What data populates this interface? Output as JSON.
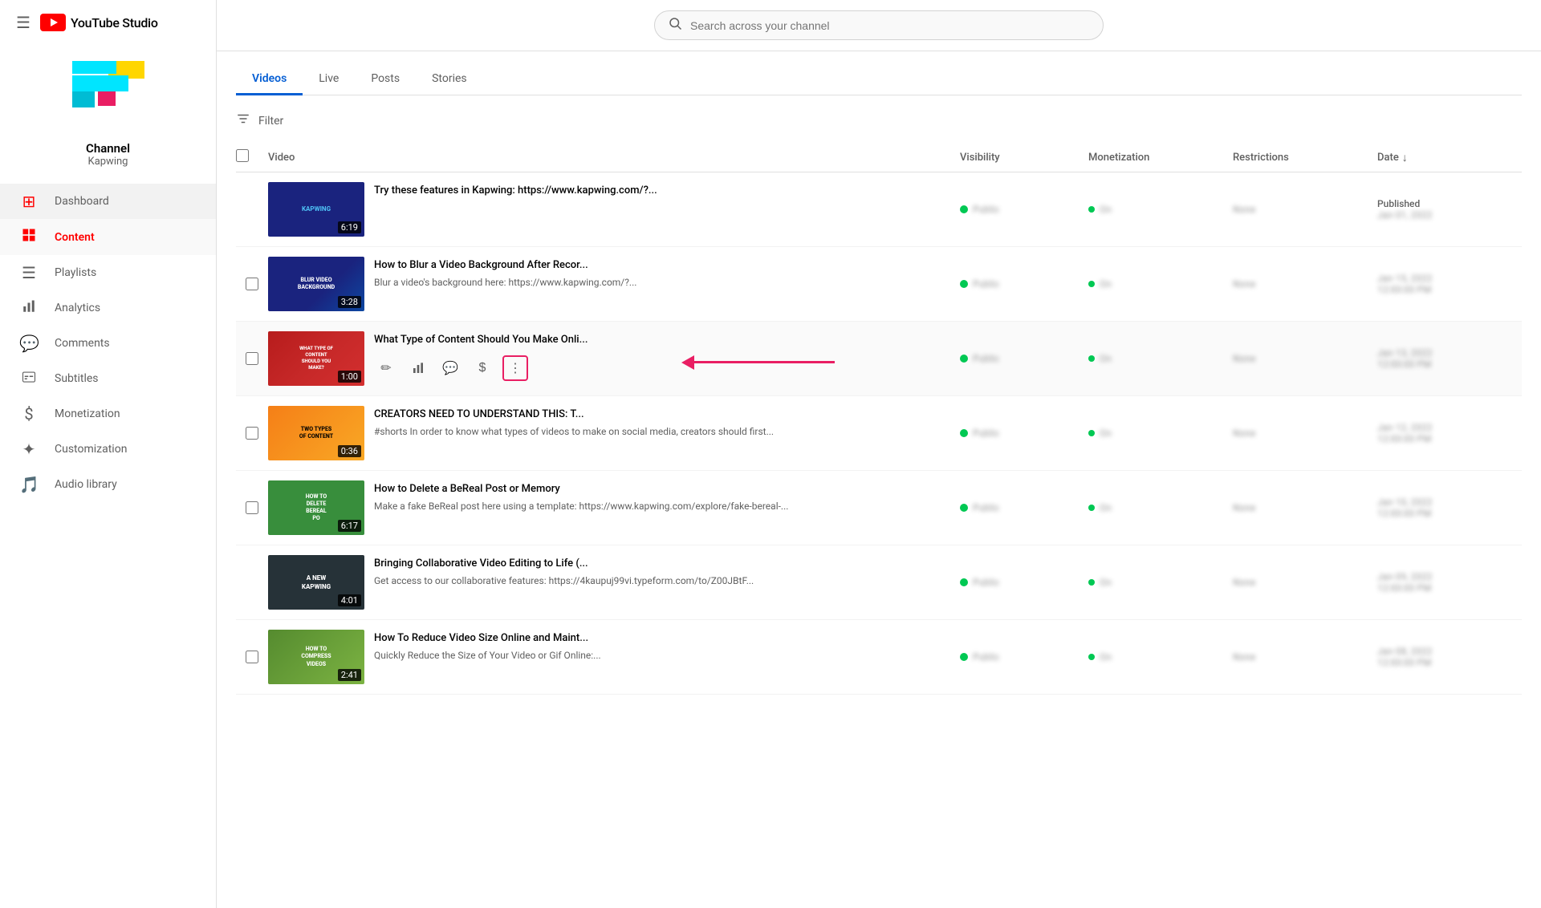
{
  "app": {
    "title": "YouTube Studio",
    "search_placeholder": "Search across your channel"
  },
  "sidebar": {
    "channel_name": "Channel",
    "channel_sub": "Kapwing",
    "nav_items": [
      {
        "id": "dashboard",
        "label": "Dashboard",
        "icon": "⊞",
        "active": false
      },
      {
        "id": "content",
        "label": "Content",
        "icon": "▶",
        "active": true
      },
      {
        "id": "playlists",
        "label": "Playlists",
        "icon": "☰",
        "active": false
      },
      {
        "id": "analytics",
        "label": "Analytics",
        "icon": "📊",
        "active": false
      },
      {
        "id": "comments",
        "label": "Comments",
        "icon": "💬",
        "active": false
      },
      {
        "id": "subtitles",
        "label": "Subtitles",
        "icon": "⬜",
        "active": false
      },
      {
        "id": "monetization",
        "label": "Monetization",
        "icon": "$",
        "active": false
      },
      {
        "id": "customization",
        "label": "Customization",
        "icon": "✦",
        "active": false
      },
      {
        "id": "audio_library",
        "label": "Audio library",
        "icon": "🎵",
        "active": false
      }
    ]
  },
  "tabs": [
    "Videos",
    "Live",
    "Posts",
    "Stories"
  ],
  "active_tab": "Videos",
  "filter_label": "Filter",
  "table": {
    "headers": {
      "video": "Video",
      "visibility": "Visibility",
      "monetization": "Monetization",
      "restrictions": "Restrictions",
      "date": "Date"
    },
    "rows": [
      {
        "id": "row0",
        "thumbnail_color": "blue",
        "thumbnail_label": "",
        "duration": "6:19",
        "title": "Try these features in Kapwing: https://www.kapwing.com/?...",
        "desc": "",
        "visibility_text": "Public",
        "date_label": "Published",
        "date_value": "",
        "show_actions": false,
        "is_partial": true
      },
      {
        "id": "row1",
        "thumbnail_color": "blue_dark",
        "thumbnail_label": "BLUR VIDEO BACKGROUND",
        "duration": "3:28",
        "title": "How to Blur a Video Background After Recor...",
        "desc": "Blur a video's background here: https://www.kapwing.com/?...",
        "visibility_text": "Public",
        "date_label": "",
        "date_value": "",
        "show_actions": false
      },
      {
        "id": "row2",
        "thumbnail_color": "red",
        "thumbnail_label": "WHAT TYPE OF CONTENT SHOULD YOU MAKE?",
        "duration": "1:00",
        "title": "What Type of Content Should You Make Onli...",
        "desc": "",
        "visibility_text": "Public",
        "date_label": "",
        "date_value": "",
        "show_actions": true,
        "has_arrow": true
      },
      {
        "id": "row3",
        "thumbnail_color": "yellow",
        "thumbnail_label": "TWO TYPES OF CONTENT",
        "duration": "0:36",
        "title": "CREATORS NEED TO UNDERSTAND THIS: T...",
        "desc": "#shorts In order to know what types of videos to make on social media, creators should first...",
        "visibility_text": "Public",
        "date_label": "",
        "date_value": "",
        "show_actions": false
      },
      {
        "id": "row4",
        "thumbnail_color": "green",
        "thumbnail_label": "HOW TO DELETE BEREAL PO",
        "duration": "6:17",
        "title": "How to Delete a BeReal Post or Memory",
        "desc": "Make a fake BeReal post here using a template: https://www.kapwing.com/explore/fake-bereal-...",
        "visibility_text": "Public",
        "date_label": "",
        "date_value": "",
        "show_actions": false
      },
      {
        "id": "row5",
        "thumbnail_color": "dark",
        "thumbnail_label": "A NEW KAPWING",
        "duration": "4:01",
        "title": "Bringing Collaborative Video Editing to Life (...",
        "desc": "Get access to our collaborative features: https://4kaupuj99vi.typeform.com/to/Z00JBtF...",
        "visibility_text": "Public",
        "date_label": "",
        "date_value": "",
        "show_actions": false
      },
      {
        "id": "row6",
        "thumbnail_color": "lime",
        "thumbnail_label": "HOW TO COMPRESS VIDEOS",
        "duration": "2:41",
        "title": "How To Reduce Video Size Online and Maint...",
        "desc": "Quickly Reduce the Size of Your Video or Gif Online:...",
        "visibility_text": "Public",
        "date_label": "",
        "date_value": "",
        "show_actions": false
      }
    ]
  },
  "action_icons": {
    "edit": "✏",
    "analytics": "📊",
    "comments": "💬",
    "money": "$",
    "more": "⋮"
  }
}
